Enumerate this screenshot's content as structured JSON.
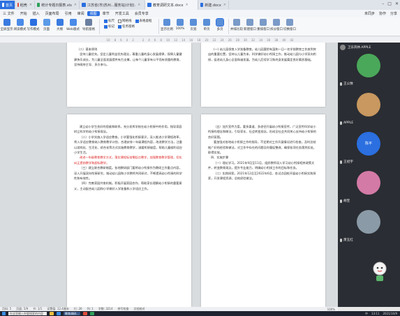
{
  "tabs": [
    {
      "label": "首页",
      "color": "#ffffff",
      "type": "home"
    },
    {
      "label": "稻壳",
      "color": "#e04b3a",
      "type": "normal"
    },
    {
      "label": "统计专题日报表.xls",
      "color": "#2ea15a",
      "type": "normal"
    },
    {
      "label": "江苏省(市)苏州...服务站(计划).",
      "color": "#2b6fe0",
      "type": "normal"
    },
    {
      "label": "教育调研文本.docx",
      "color": "#2b6fe0",
      "type": "active"
    },
    {
      "label": "新建.docx",
      "color": "#2b6fe0",
      "type": "normal"
    }
  ],
  "menu": [
    "三 文件",
    "开始",
    "插入",
    "页面布局",
    "引用",
    "审阅",
    "视图",
    "章节",
    "开发工具",
    "会员专享"
  ],
  "menu_active": "视图",
  "menu_right": [
    "未同步",
    "协作",
    "分享"
  ],
  "ribbon": {
    "view_buttons": [
      "全屏显示",
      "阅读模式",
      "写作模式",
      "页面",
      "大纲",
      "Web版式"
    ],
    "nav_button": "导航窗格",
    "checks": [
      {
        "label": "标尺",
        "on": true
      },
      {
        "label": "网格线",
        "on": false
      },
      {
        "label": "表格虚框",
        "on": true
      },
      {
        "label": "标记",
        "on": true
      },
      {
        "label": "任务窗格",
        "on": true
      }
    ],
    "zoom_buttons": [
      "显示比例",
      "100%",
      "页宽",
      "单页",
      "多页"
    ],
    "other_buttons": [
      "并排比较",
      "新建窗口",
      "重排窗口",
      "拆分窗口",
      "切换窗口"
    ],
    "selected": "多页"
  },
  "ruler": [
    "10",
    "8",
    "6",
    "4",
    "2",
    "",
    "2",
    "4",
    "6",
    "8",
    "10",
    "12",
    "14",
    "16",
    "18",
    "20",
    "22",
    "24",
    "26",
    "28",
    "30",
    "32",
    "34",
    "36",
    "38",
    "40",
    "42"
  ],
  "pages": {
    "top_left": [
      {
        "kind": "heading",
        "text": "（二）基本原则"
      },
      {
        "kind": "para",
        "text": "坚持儿童优先。坚定儿童利益优先理念，尊重儿童的身心发展规律，保障儿童健康快乐成长，为儿童全面发展提供有力支撑，让每个儿童享有公平而有质量的教育，坚持政府主导、多方参与。"
      }
    ],
    "top_right": [
      {
        "kind": "para",
        "text": "(一) 幼儿园保育入学准备教育。幼儿园要把有温和一日一名学前教育工作放到突出的重要位置，坚持以儿童为本，科学做好幼小衔接工作，推动幼儿园与小学双向衔接，促进幼儿身心全面和谐发展，为幼儿后续学习和终身发展奠定良好素质基础。"
      }
    ],
    "bottom_left": [
      {
        "kind": "para",
        "text": "建立幼小学生良好的思维和联系，充分发挥学校在幼小衔接中的作用，指导家庭树立科学的幼小衔接观念。"
      },
      {
        "kind": "para",
        "text": "（二）小学实施入学适应教育。小学要强化衔接意识，深入推进小学课程改革，将入学适应教育纳入教育教学计划，合理安排一年级课程内容，改进教学方法，注重以游戏化、生活化、综合化等方式实施教育教学，减缓衔接坡度，帮助儿童顺利适应小学生活。"
      },
      {
        "kind": "red",
        "text": "改进一年级教育教学方式，落实课程标准零起点教学，加强教育教学管理，切实纠正提前教学和超标教学。"
      },
      {
        "kind": "para",
        "text": "（三）建立联合教研制度。各地教研部门要将幼小衔接作为教研工作重点内容，深入开展双向衔接研究，推动幼儿园和小学教师共同研讨，不断提高幼小衔接的科学性和有效性。"
      },
      {
        "kind": "para",
        "text": "（四）完善家园共育机制。积极开展家园合作，帮助家长理解幼小衔接的重要意义，主动配合幼儿园和小学做好入学准备和入学适应工作。"
      }
    ],
    "bottom_right": [
      {
        "kind": "para",
        "text": "（五）加大宣传力度。要多渠道、多途径开展幼小衔接宣传，广泛宣传科学幼小衔接的理念和做法，引导家长、社会转变观念，形成全社会共同关心支持幼小衔接的良好氛围。"
      },
      {
        "kind": "para",
        "text": "要加强对各地幼小衔接工作的指导，不定期对工作开展情况进行检查，及时总结推广好的经验和做法，对工作中存在的问题及时督促整改，确保各项任务落到实处，取得实效。"
      },
      {
        "kind": "heading",
        "text": "四、实施步骤"
      },
      {
        "kind": "para",
        "text": "（一）理论学习。2021年9月至11月，组织教师深入学习幼小衔接相关政策文件，转变教育观念，提升专业能力，明确幼小衔接工作的目标和任务。"
      },
      {
        "kind": "para",
        "text": "（二）实践探索。2021年12月至2022年6月，各试点园校开展幼小衔接实践探索，开发课程资源，总结经验做法。"
      }
    ]
  },
  "panel": {
    "title": "卫东风林.APPLE",
    "participants": [
      {
        "name": "王公致",
        "color": "#4aa85a"
      },
      {
        "name": "APPLE",
        "color": "#c89860"
      },
      {
        "name": "王绍宇",
        "color": "#2b6fe0",
        "avatar_text": "陈平"
      },
      {
        "name": "胡宝",
        "color": "#d47aa6"
      },
      {
        "name": "萧玉红",
        "color": "#8a9aa6"
      }
    ]
  },
  "status": {
    "items": [
      "页码: 5",
      "页面: 5/9",
      "节: 1/1",
      "设置值: 12.4厘米",
      "行: 26",
      "列: 1",
      "字数: 3214",
      "拼写检查",
      "文档校对"
    ],
    "zoom": "100%"
  },
  "taskbar": {
    "search": "在这里输入你要搜索的内容",
    "active_app": "教育调研...",
    "tray": [
      "中",
      "13:11",
      "2021/10/9"
    ]
  }
}
